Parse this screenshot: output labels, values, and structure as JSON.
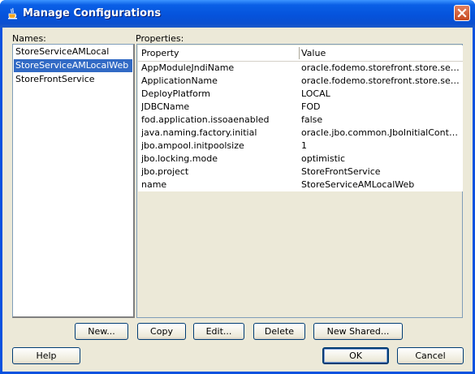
{
  "window": {
    "title": "Manage Configurations"
  },
  "names": {
    "label": "Names:",
    "items": [
      "StoreServiceAMLocal",
      "StoreServiceAMLocalWeb",
      "StoreFrontService"
    ],
    "selected_index": 1
  },
  "properties": {
    "label": "Properties:",
    "columns": [
      "Property",
      "Value"
    ],
    "rows": [
      [
        "AppModuleJndiName",
        "oracle.fodemo.storefront.store.servic..."
      ],
      [
        "ApplicationName",
        "oracle.fodemo.storefront.store.servic..."
      ],
      [
        "DeployPlatform",
        "LOCAL"
      ],
      [
        "JDBCName",
        "FOD"
      ],
      [
        "fod.application.issoaenabled",
        "false"
      ],
      [
        "java.naming.factory.initial",
        "oracle.jbo.common.JboInitialContextF..."
      ],
      [
        "jbo.ampool.initpoolsize",
        "1"
      ],
      [
        "jbo.locking.mode",
        "optimistic"
      ],
      [
        "jbo.project",
        "StoreFrontService"
      ],
      [
        "name",
        "StoreServiceAMLocalWeb"
      ]
    ]
  },
  "buttons": {
    "new": "New...",
    "copy": "Copy",
    "edit": "Edit...",
    "delete": "Delete",
    "new_shared": "New Shared...",
    "help": "Help",
    "ok": "OK",
    "cancel": "Cancel"
  },
  "icons": {
    "title_icon": "java-cup-icon",
    "close": "close-icon"
  },
  "colors": {
    "titlebar": "#0553dc",
    "selection": "#316ac5",
    "dialog_bg": "#ece9d8"
  }
}
